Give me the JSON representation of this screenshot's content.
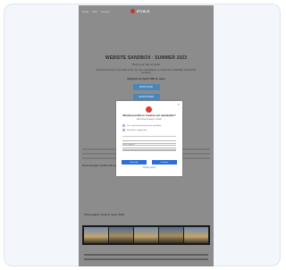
{
  "topbar": {
    "nav_items": [
      "Hotel",
      "Kids",
      "Groups"
    ],
    "logo_text": "ETOILE"
  },
  "hero": {
    "title": "WEBSITE SANDBOX · SUMMER 2023",
    "subtitle": "Book your stay at Hotel",
    "body": "Experience luxury in the heart of the city. Free cancellation on most rooms. Breakfast included for members.",
    "strong": "Register by April 30th to save",
    "cta_label": "BOOK NOW",
    "cta2_label": "LEARN MORE"
  },
  "content": {
    "note": "Resort amenities included with every booking"
  },
  "gallery": {
    "title": "Photo gallery: Hotel & resort 2023"
  },
  "modal": {
    "close_glyph": "×",
    "title": "Would you like to receive our newsletter?",
    "subtitle": "We'd love to keep in touch",
    "options": [
      "Yes, send me the latest news and offers",
      "No thanks, maybe later"
    ],
    "field_placeholder": "Email address",
    "primary_label": "Subscribe",
    "secondary_label": "Continue",
    "link_label": "Privacy policy"
  },
  "colors": {
    "modal_button": "#2b6fd6",
    "logo_red": "#e13b2f",
    "overlay_bg": "#8c8c8c"
  }
}
